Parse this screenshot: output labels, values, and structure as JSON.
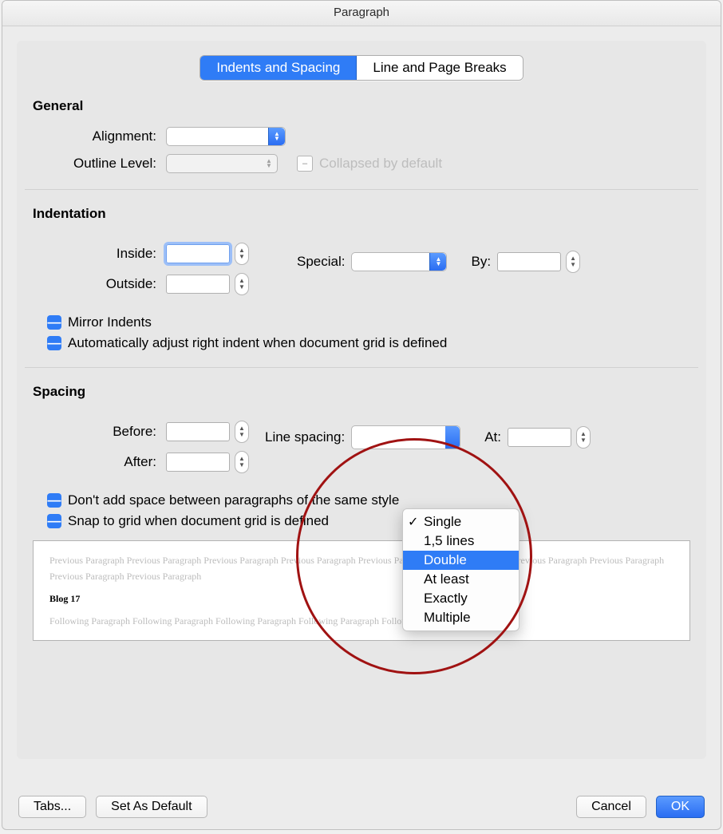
{
  "window": {
    "title": "Paragraph"
  },
  "tabs": {
    "indents_spacing": "Indents and Spacing",
    "line_page_breaks": "Line and Page Breaks"
  },
  "general": {
    "heading": "General",
    "alignment_label": "Alignment:",
    "alignment_value": "",
    "outline_label": "Outline Level:",
    "outline_value": "",
    "collapsed_label": "Collapsed by default"
  },
  "indentation": {
    "heading": "Indentation",
    "inside_label": "Inside:",
    "inside_value": "",
    "outside_label": "Outside:",
    "outside_value": "",
    "special_label": "Special:",
    "special_value": "",
    "by_label": "By:",
    "by_value": "",
    "mirror_label": "Mirror Indents",
    "auto_adjust_label": "Automatically adjust right indent when document grid is defined"
  },
  "spacing": {
    "heading": "Spacing",
    "before_label": "Before:",
    "before_value": "",
    "after_label": "After:",
    "after_value": "",
    "line_spacing_label": "Line spacing:",
    "at_label": "At:",
    "at_value": "",
    "dont_add_label": "Don't add space between paragraphs of the same style",
    "snap_label": "Snap to grid when document grid is defined",
    "options": {
      "single": "Single",
      "one_half": "1,5 lines",
      "double": "Double",
      "at_least": "At least",
      "exactly": "Exactly",
      "multiple": "Multiple"
    },
    "selected_option": "Single",
    "highlighted_option": "Double"
  },
  "preview": {
    "prev_text": "Previous Paragraph Previous Paragraph Previous Paragraph Previous Paragraph Previous Paragraph Previous Paragraph Previous Paragraph Previous Paragraph Previous Paragraph Previous Paragraph",
    "current_text": "Blog 17",
    "next_text": "Following Paragraph Following Paragraph Following Paragraph Following Paragraph Following Paragraph"
  },
  "footer": {
    "tabs": "Tabs...",
    "set_default": "Set As Default",
    "cancel": "Cancel",
    "ok": "OK"
  }
}
